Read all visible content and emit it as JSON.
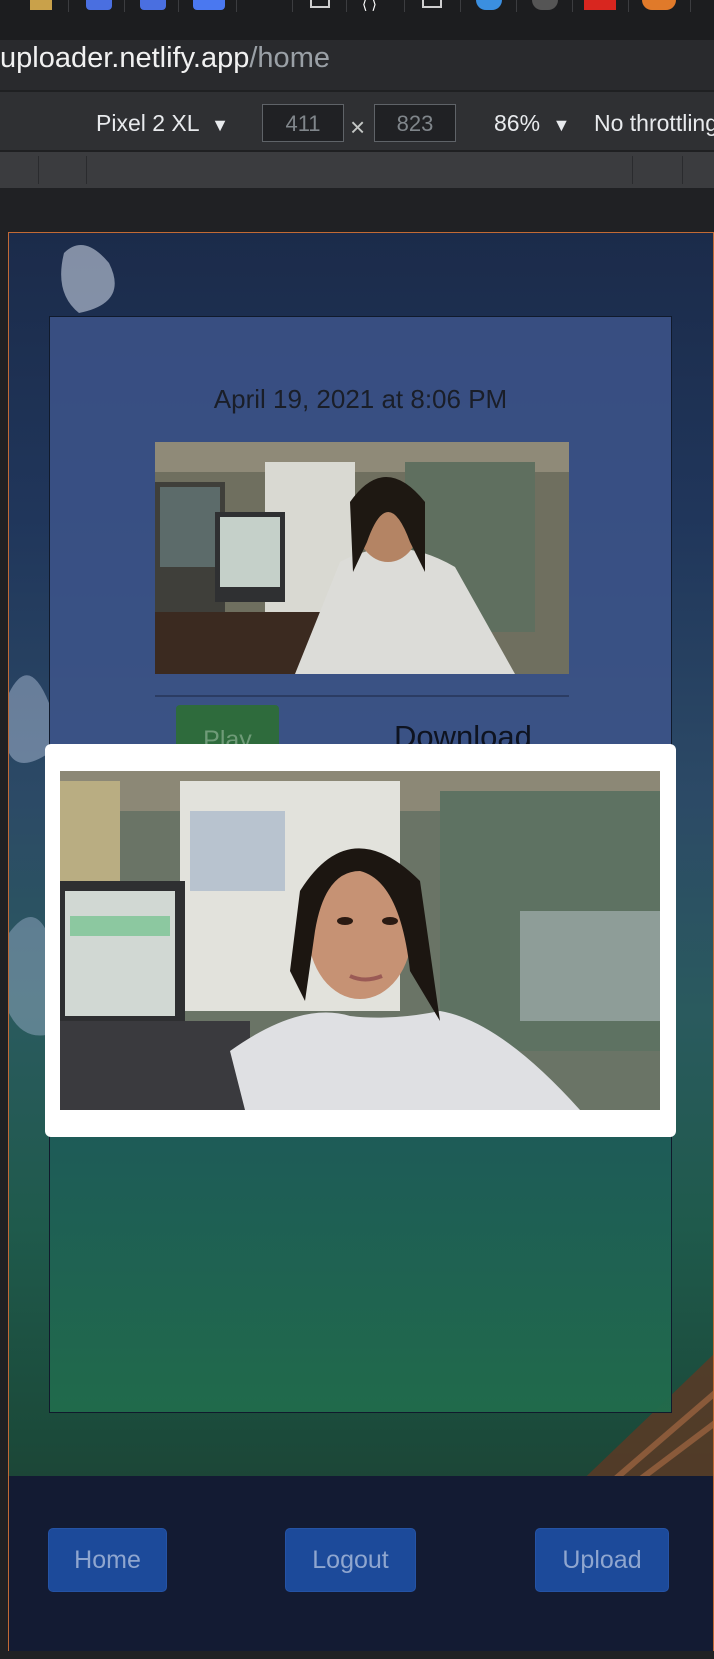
{
  "browser": {
    "url_host": "uploader.netlify.app",
    "url_path": "/home"
  },
  "devtools": {
    "device": "Pixel 2 XL",
    "width": "411",
    "height": "823",
    "times": "×",
    "zoom": "86%",
    "throttling": "No throttling",
    "device_caret": "▼",
    "zoom_caret": "▼"
  },
  "post": {
    "date": "April 19, 2021 at 8:06 PM",
    "play_label": "Play",
    "download_label": "Download"
  },
  "footer": {
    "home_label": "Home",
    "logout_label": "Logout",
    "upload_label": "Upload"
  },
  "colors": {
    "accent": "#1c4a9a",
    "play_green": "#2e6b3c",
    "viewport_border": "#c26a35"
  }
}
